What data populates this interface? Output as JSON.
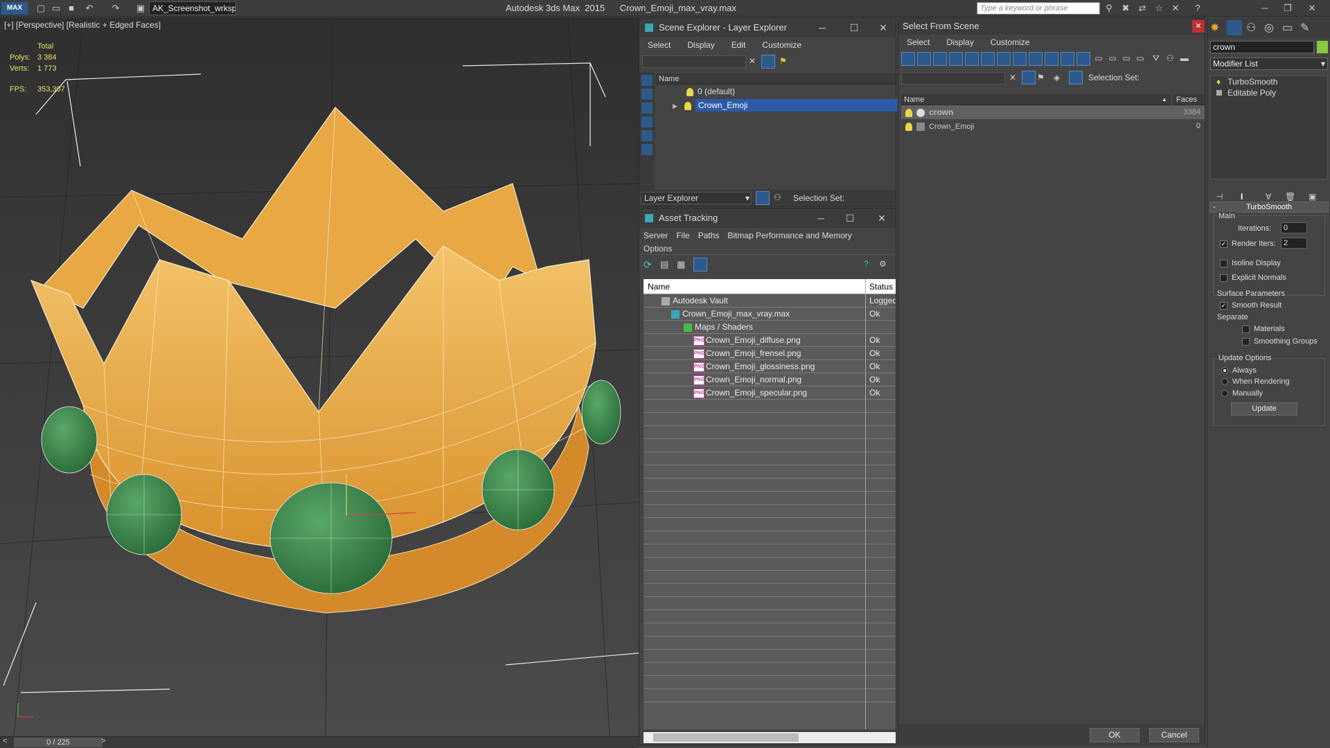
{
  "titlebar": {
    "workspace": "AK_Screenshot_wrksp",
    "app_name": "Autodesk 3ds Max  2015",
    "file_name": "Crown_Emoji_max_vray.max",
    "search_placeholder": "Type a keyword or phrase",
    "logo": "MAX"
  },
  "viewport": {
    "label": "[+] [Perspective] [Realistic + Edged Faces]",
    "stats": {
      "total_label": "Total",
      "polys_label": "Polys:",
      "polys_value": "3 384",
      "verts_label": "Verts:",
      "verts_value": "1 773",
      "fps_label": "FPS:",
      "fps_value": "353,307"
    },
    "timeslider": "0 / 225"
  },
  "scene_explorer": {
    "title": "Scene Explorer - Layer Explorer",
    "menu": [
      "Select",
      "Display",
      "Edit",
      "Customize"
    ],
    "col_name": "Name",
    "rows": [
      "0 (default)",
      "Crown_Emoji"
    ],
    "footer_combo": "Layer Explorer",
    "selection_set_label": "Selection Set:"
  },
  "asset_tracking": {
    "title": "Asset Tracking",
    "menu": [
      "Server",
      "File",
      "Paths",
      "Bitmap Performance and Memory",
      "Options"
    ],
    "col_name": "Name",
    "col_status": "Status",
    "rows": [
      {
        "name": "Autodesk Vault",
        "status": "Logged"
      },
      {
        "name": "Crown_Emoji_max_vray.max",
        "status": "Ok"
      },
      {
        "name": "Maps / Shaders",
        "status": ""
      },
      {
        "name": "Crown_Emoji_diffuse.png",
        "status": "Ok"
      },
      {
        "name": "Crown_Emoji_frensel.png",
        "status": "Ok"
      },
      {
        "name": "Crown_Emoji_glossiness.png",
        "status": "Ok"
      },
      {
        "name": "Crown_Emoji_normal.png",
        "status": "Ok"
      },
      {
        "name": "Crown_Emoji_specular.png",
        "status": "Ok"
      }
    ],
    "png_badge": "PNG"
  },
  "select_from_scene": {
    "title": "Select From Scene",
    "menu": [
      "Select",
      "Display",
      "Customize"
    ],
    "selection_set_label": "Selection Set:",
    "col_name": "Name",
    "col_faces": "Faces",
    "rows": [
      {
        "name": "crown",
        "faces": "3384"
      },
      {
        "name": "Crown_Emoji",
        "faces": "0"
      }
    ],
    "ok": "OK",
    "cancel": "Cancel"
  },
  "command_panel": {
    "object_name": "crown",
    "modifier_list": "Modifier List",
    "stack": [
      "TurboSmooth",
      "Editable Poly"
    ],
    "rollout_title": "TurboSmooth",
    "main_label": "Main",
    "iterations_label": "Iterations:",
    "iterations_value": "0",
    "render_iters_label": "Render Iters:",
    "render_iters_value": "2",
    "isoline": "Isoline Display",
    "explicit_normals": "Explicit Normals",
    "surface_params": "Surface Parameters",
    "smooth_result": "Smooth Result",
    "separate": "Separate",
    "materials": "Materials",
    "smoothing_groups": "Smoothing Groups",
    "update_options": "Update Options",
    "always": "Always",
    "when_rendering": "When Rendering",
    "manually": "Manually",
    "update_btn": "Update",
    "collapse": "-"
  },
  "colors": {
    "selection_blue": "#2d5aa8",
    "crown_gold": "#e8a844",
    "gem_green": "#3a8a4a",
    "stats_yellow": "#e8e26a"
  }
}
